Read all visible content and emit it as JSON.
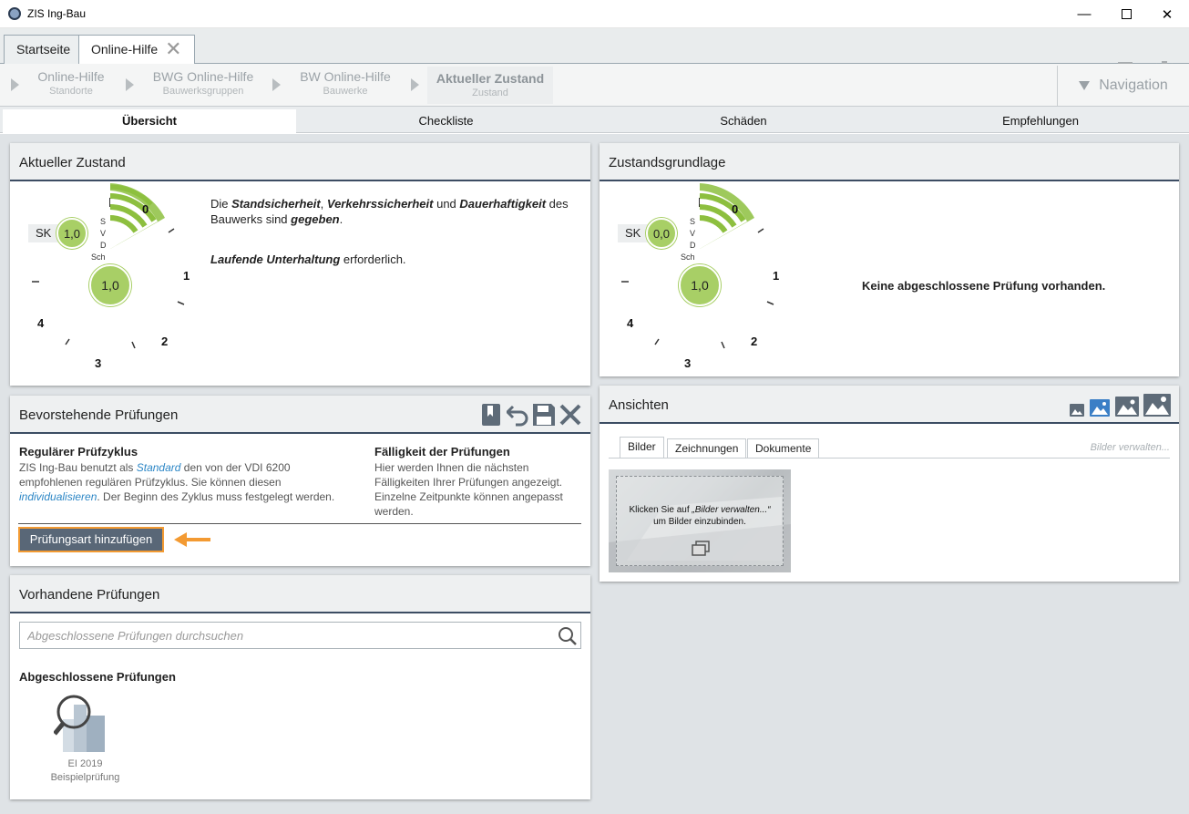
{
  "window": {
    "title": "ZIS Ing-Bau"
  },
  "tabs": [
    {
      "label": "Startseite"
    },
    {
      "label": "Online-Hilfe"
    }
  ],
  "breadcrumb": [
    {
      "title": "Online-Hilfe",
      "sub": "Standorte"
    },
    {
      "title": "BWG Online-Hilfe",
      "sub": "Bauwerksgruppen"
    },
    {
      "title": "BW Online-Hilfe",
      "sub": "Bauwerke"
    },
    {
      "title": "Aktueller Zustand",
      "sub": "Zustand"
    }
  ],
  "navigation_label": "Navigation",
  "subtabs": [
    "Übersicht",
    "Checkliste",
    "Schäden",
    "Empfehlungen"
  ],
  "aktueller_zustand": {
    "title": "Aktueller Zustand",
    "sk_label": "SK",
    "sk_value": "1,0",
    "main_value": "1,0",
    "labels": [
      "S",
      "V",
      "D",
      "Sch"
    ],
    "scale": [
      "0",
      "1",
      "2",
      "3",
      "4"
    ],
    "text_pre": "Die ",
    "t1": "Standsicherheit",
    "sep1": ", ",
    "t2": "Verkehrssicherheit",
    "sep2": " und ",
    "t3": "Dauerhaftigkeit",
    "text_mid": " des Bauwerks sind ",
    "t4": "gegeben",
    "text_end": ".",
    "l2_bold": "Laufende Unterhaltung",
    "l2_rest": " erforderlich."
  },
  "zustandsgrundlage": {
    "title": "Zustandsgrundlage",
    "sk_label": "SK",
    "sk_value": "0,0",
    "main_value": "1,0",
    "labels": [
      "S",
      "V",
      "D",
      "Sch"
    ],
    "scale": [
      "0",
      "1",
      "2",
      "3",
      "4"
    ],
    "message": "Keine abgeschlossene Prüfung vorhanden."
  },
  "bevorstehende": {
    "title": "Bevorstehende Prüfungen",
    "left_heading": "Regulärer Prüfzyklus",
    "left_p1": "ZIS Ing-Bau benutzt als ",
    "left_link1": "Standard",
    "left_p2": " den von der VDI 6200 empfohlenen regulären Prüfzyklus. Sie können diesen ",
    "left_link2": "individualisieren",
    "left_p3": ". Der Beginn des Zyklus muss  festgelegt werden.",
    "right_heading": "Fälligkeit der Prüfungen",
    "right_text": "Hier werden Ihnen die nächsten Fälligkeiten Ihrer Prüfungen angezeigt. Einzelne Zeitpunkte können angepasst werden.",
    "add_button": "Prüfungsart hinzufügen"
  },
  "vorhandene": {
    "title": "Vorhandene Prüfungen",
    "search_placeholder": "Abgeschlossene Prüfungen durchsuchen",
    "heading": "Abgeschlossene Prüfungen",
    "item_line1": "EI 2019",
    "item_line2": "Beispielprüfung"
  },
  "ansichten": {
    "title": "Ansichten",
    "tabs": [
      "Bilder",
      "Zeichnungen",
      "Dokumente"
    ],
    "manage_link": "Bilder verwalten...",
    "hint_pre": "Klicken Sie auf ",
    "hint_link": "„Bilder verwalten...“",
    "hint_post": "um Bilder einzubinden."
  },
  "colors": {
    "accent_green": "#a8cf66",
    "header_line": "#3c4d63",
    "highlight_orange": "#f39a32"
  }
}
